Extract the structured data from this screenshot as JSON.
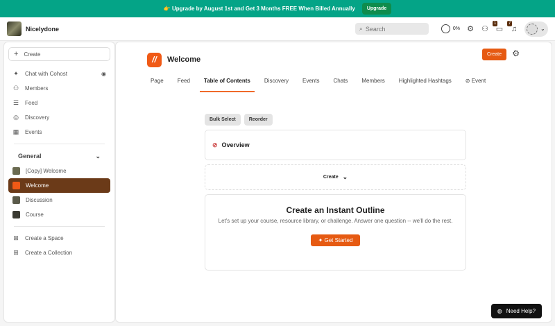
{
  "banner": {
    "emoji": "👉",
    "text": "Upgrade by August 1st and Get 3 Months FREE When Billed Annually",
    "button": "Upgrade"
  },
  "topbar": {
    "brand": "Nicelydone",
    "search_placeholder": "Search",
    "progress": "0%",
    "badges": {
      "chats": "1",
      "notifications": "7"
    }
  },
  "sidebar": {
    "create": "Create",
    "items": [
      {
        "label": "Chat with Cohost",
        "icon": "sparkle-icon"
      },
      {
        "label": "Members",
        "icon": "members-icon"
      },
      {
        "label": "Feed",
        "icon": "feed-icon"
      },
      {
        "label": "Discovery",
        "icon": "compass-icon"
      },
      {
        "label": "Events",
        "icon": "calendar-icon"
      }
    ],
    "section": "General",
    "spaces": [
      {
        "label": "[Copy] Welcome"
      },
      {
        "label": "Welcome",
        "active": true
      },
      {
        "label": "Discussion"
      },
      {
        "label": "Course"
      }
    ],
    "footer": [
      {
        "label": "Create a Space"
      },
      {
        "label": "Create a Collection"
      }
    ]
  },
  "main": {
    "title": "Welcome",
    "create": "Create",
    "tabs": [
      "Page",
      "Feed",
      "Table of Contents",
      "Discovery",
      "Events",
      "Chats",
      "Members",
      "Highlighted Hashtags",
      "Event"
    ],
    "active_tab": "Table of Contents",
    "bulk_select": "Bulk Select",
    "reorder": "Reorder",
    "overview": "Overview",
    "create_dropdown": "Create",
    "outline": {
      "title": "Create an Instant Outline",
      "text": "Let's set up your course, resource library, or challenge. Answer one question -- we'll do the rest.",
      "button": "Get Started"
    }
  },
  "help": "Need Help?",
  "colors": {
    "banner": "#04a487",
    "accent": "#e65a12",
    "active": "#6b3a18"
  }
}
